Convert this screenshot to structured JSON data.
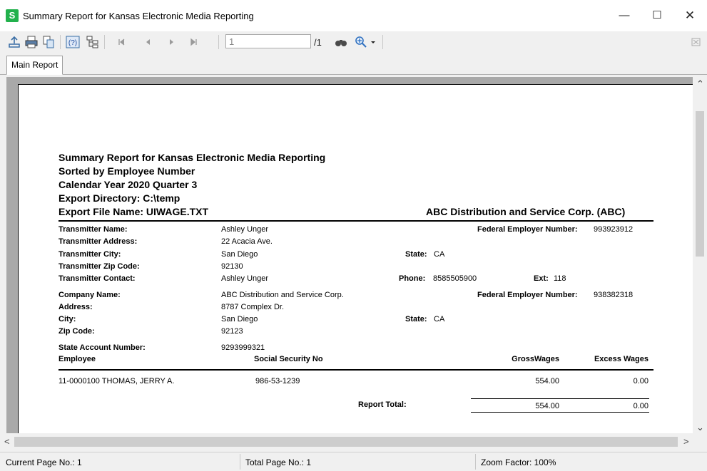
{
  "window": {
    "app_icon_letter": "S",
    "title": "Summary Report for Kansas Electronic Media Reporting",
    "minimize": "—",
    "maximize": "☐",
    "close": "✕"
  },
  "toolbar": {
    "page_input_value": "1",
    "page_total": "/1",
    "icons": [
      "export-icon",
      "print-icon",
      "copy-icon",
      "help-icon",
      "group-tree-icon",
      "first-page-icon",
      "prev-page-icon",
      "next-page-icon",
      "last-page-icon",
      "search-icon",
      "zoom-icon",
      "close-view-icon"
    ]
  },
  "tabs": {
    "main_report": "Main Report"
  },
  "report": {
    "title_lines": [
      "Summary Report for Kansas Electronic Media Reporting",
      "Sorted by Employee Number",
      "Calendar Year 2020 Quarter 3",
      "Export Directory: C:\\temp",
      "Export File Name: UIWAGE.TXT"
    ],
    "company_header": "ABC Distribution and Service Corp. (ABC)",
    "transmitter": {
      "name_label": "Transmitter Name:",
      "name": "Ashley Unger",
      "address_label": "Transmitter Address:",
      "address": "22 Acacia Ave.",
      "city_label": "Transmitter City:",
      "city": "San Diego",
      "zip_label": "Transmitter Zip Code:",
      "zip": "92130",
      "contact_label": "Transmitter Contact:",
      "contact": "Ashley Unger",
      "fein_label": "Federal Employer Number:",
      "fein": "993923912",
      "state_label": "State:",
      "state": "CA",
      "phone_label": "Phone:",
      "phone": "8585505900",
      "ext_label": "Ext:",
      "ext": "118"
    },
    "company": {
      "name_label": "Company Name:",
      "name": "ABC Distribution and Service Corp.",
      "address_label": "Address:",
      "address": "8787 Complex Dr.",
      "city_label": "City:",
      "city": "San Diego",
      "zip_label": "Zip Code:",
      "zip": "92123",
      "fein_label": "Federal Employer Number:",
      "fein": "938382318",
      "state_label": "State:",
      "state": "CA",
      "state_account_label": "State Account Number:",
      "state_account": "9293999321"
    },
    "columns": {
      "employee": "Employee",
      "ssn": "Social Security No",
      "gross": "GrossWages",
      "excess": "Excess Wages"
    },
    "rows": [
      {
        "employee": "11-0000100  THOMAS, JERRY A.",
        "ssn": "986-53-1239",
        "gross": "554.00",
        "excess": "0.00"
      }
    ],
    "total": {
      "label": "Report Total:",
      "gross": "554.00",
      "excess": "0.00"
    }
  },
  "status": {
    "current_page": "Current Page No.: 1",
    "total_page": "Total Page No.: 1",
    "zoom": "Zoom Factor: 100%"
  }
}
